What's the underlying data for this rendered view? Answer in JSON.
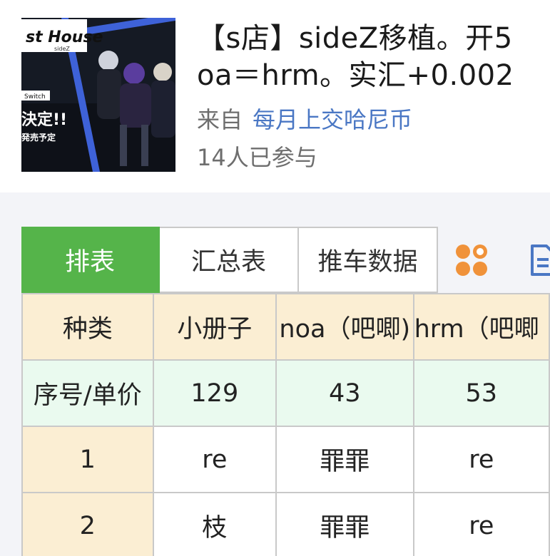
{
  "header": {
    "title_line1": "【s店】sideZ移植。开5",
    "title_line2": "oa＝hrm。实汇+0.002",
    "from_prefix": "来自",
    "from_link": "每月上交哈尼币",
    "participants": "14人已参与",
    "cover": {
      "logo_text": "st House",
      "logo_small": "sideZ",
      "switch_label": "Switch",
      "decide_text": "決定!!",
      "release_text": "発売予定"
    }
  },
  "tabs": [
    {
      "label": "排表",
      "active": true
    },
    {
      "label": "汇总表",
      "active": false
    },
    {
      "label": "推车数据",
      "active": false
    }
  ],
  "icons": {
    "grid_icon": "grid-four-icon",
    "doc_icon": "document-icon",
    "grid_icon_color": "#f0923a",
    "doc_icon_color": "#4a77c4"
  },
  "table": {
    "header_row": [
      "种类",
      "小册子",
      "noa（吧唧)",
      "hrm（吧唧"
    ],
    "price_row": [
      "序号/单价",
      "129",
      "43",
      "53"
    ],
    "rows": [
      [
        "1",
        "re",
        "罪罪",
        "re"
      ],
      [
        "2",
        "枝",
        "罪罪",
        "re"
      ]
    ]
  },
  "colors": {
    "active_tab": "#55b44a",
    "type_row_bg": "#fbeed3",
    "price_row_bg": "#eafaef",
    "link": "#4a77c4",
    "page_bg": "#f3f4f8"
  }
}
